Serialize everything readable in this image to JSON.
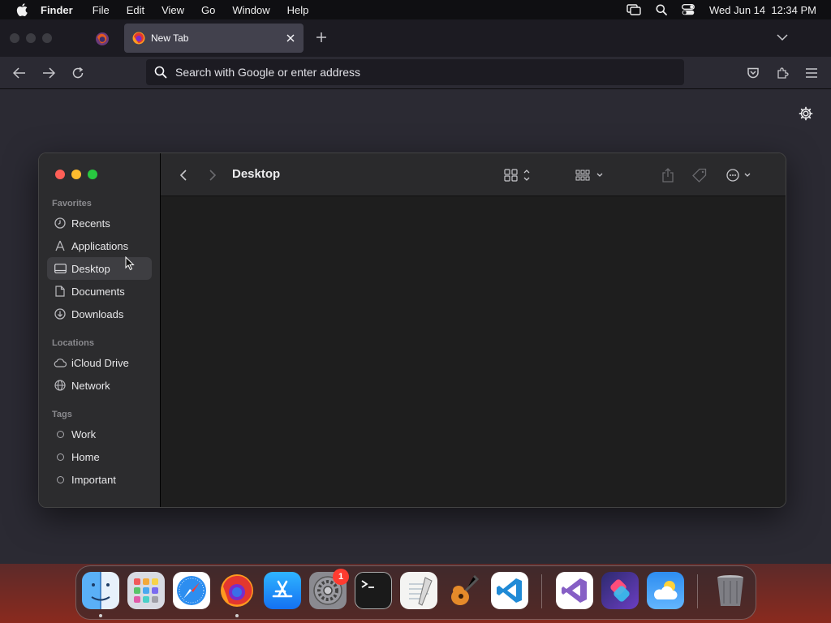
{
  "menubar": {
    "app_name": "Finder",
    "items": [
      "File",
      "Edit",
      "View",
      "Go",
      "Window",
      "Help"
    ],
    "clock": "Wed Jun 14  12:34 PM"
  },
  "browser": {
    "active_tab_title": "New Tab",
    "urlbar_placeholder": "Search with Google or enter address"
  },
  "finder": {
    "title": "Desktop",
    "sections": {
      "favorites": "Favorites",
      "locations": "Locations",
      "tags": "Tags"
    },
    "favorites": [
      {
        "label": "Recents",
        "icon": "clock-icon"
      },
      {
        "label": "Applications",
        "icon": "applications-icon"
      },
      {
        "label": "Desktop",
        "icon": "desktop-icon",
        "selected": true
      },
      {
        "label": "Documents",
        "icon": "document-icon"
      },
      {
        "label": "Downloads",
        "icon": "download-icon"
      }
    ],
    "locations": [
      {
        "label": "iCloud Drive",
        "icon": "cloud-icon"
      },
      {
        "label": "Network",
        "icon": "globe-icon"
      }
    ],
    "tags": [
      {
        "label": "Work"
      },
      {
        "label": "Home"
      },
      {
        "label": "Important"
      }
    ]
  },
  "dock": {
    "apps": [
      "Finder",
      "Launchpad",
      "Safari",
      "Firefox",
      "App Store",
      "System Settings",
      "Terminal",
      "TextEdit",
      "GarageBand",
      "Visual Studio Code",
      "Visual Studio",
      "Shortcuts",
      "Weather",
      "Trash"
    ],
    "settings_badge": "1"
  },
  "colors": {
    "finder_red": "#ff5f57",
    "finder_yellow": "#febc2e",
    "finder_green": "#28c840",
    "badge_red": "#ff3b30"
  }
}
